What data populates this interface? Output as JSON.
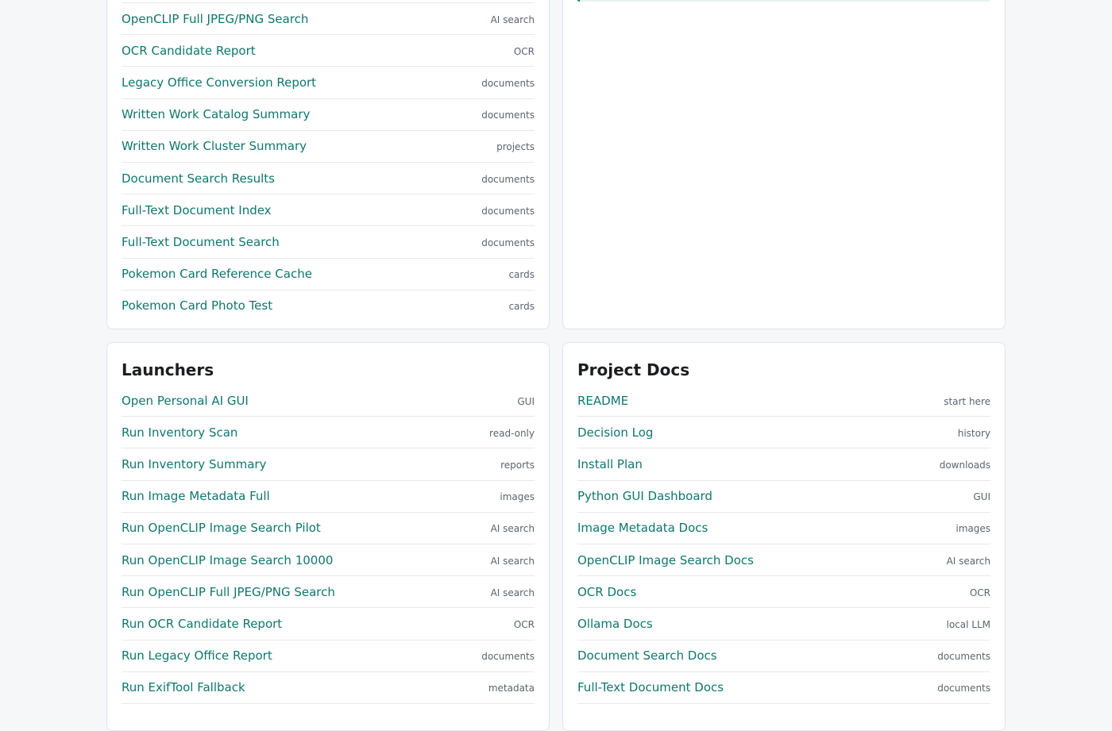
{
  "reports": {
    "items": [
      {
        "label": "OpenCLIP Full JPEG/PNG Search",
        "tag": "AI search"
      },
      {
        "label": "OCR Candidate Report",
        "tag": "OCR"
      },
      {
        "label": "Legacy Office Conversion Report",
        "tag": "documents"
      },
      {
        "label": "Written Work Catalog Summary",
        "tag": "documents"
      },
      {
        "label": "Written Work Cluster Summary",
        "tag": "projects"
      },
      {
        "label": "Document Search Results",
        "tag": "documents"
      },
      {
        "label": "Full-Text Document Index",
        "tag": "documents"
      },
      {
        "label": "Full-Text Document Search",
        "tag": "documents"
      },
      {
        "label": "Pokemon Card Reference Cache",
        "tag": "cards"
      },
      {
        "label": "Pokemon Card Photo Test",
        "tag": "cards"
      }
    ]
  },
  "right_panel": {
    "progress_fraction": 0.005
  },
  "launchers": {
    "title": "Launchers",
    "items": [
      {
        "label": "Open Personal AI GUI",
        "tag": "GUI"
      },
      {
        "label": "Run Inventory Scan",
        "tag": "read-only"
      },
      {
        "label": "Run Inventory Summary",
        "tag": "reports"
      },
      {
        "label": "Run Image Metadata Full",
        "tag": "images"
      },
      {
        "label": "Run OpenCLIP Image Search Pilot",
        "tag": "AI search"
      },
      {
        "label": "Run OpenCLIP Image Search 10000",
        "tag": "AI search"
      },
      {
        "label": "Run OpenCLIP Full JPEG/PNG Search",
        "tag": "AI search"
      },
      {
        "label": "Run OCR Candidate Report",
        "tag": "OCR"
      },
      {
        "label": "Run Legacy Office Report",
        "tag": "documents"
      },
      {
        "label": "Run ExifTool Fallback",
        "tag": "metadata"
      }
    ]
  },
  "project_docs": {
    "title": "Project Docs",
    "items": [
      {
        "label": "README",
        "tag": "start here"
      },
      {
        "label": "Decision Log",
        "tag": "history"
      },
      {
        "label": "Install Plan",
        "tag": "downloads"
      },
      {
        "label": "Python GUI Dashboard",
        "tag": "GUI"
      },
      {
        "label": "Image Metadata Docs",
        "tag": "images"
      },
      {
        "label": "OpenCLIP Image Search Docs",
        "tag": "AI search"
      },
      {
        "label": "OCR Docs",
        "tag": "OCR"
      },
      {
        "label": "Ollama Docs",
        "tag": "local LLM"
      },
      {
        "label": "Document Search Docs",
        "tag": "documents"
      },
      {
        "label": "Full-Text Document Docs",
        "tag": "documents"
      }
    ]
  },
  "colors": {
    "accent": "#0f766e",
    "tag_text": "#5b6470",
    "heading": "#1a1d21",
    "background": "#f6f7f9"
  }
}
